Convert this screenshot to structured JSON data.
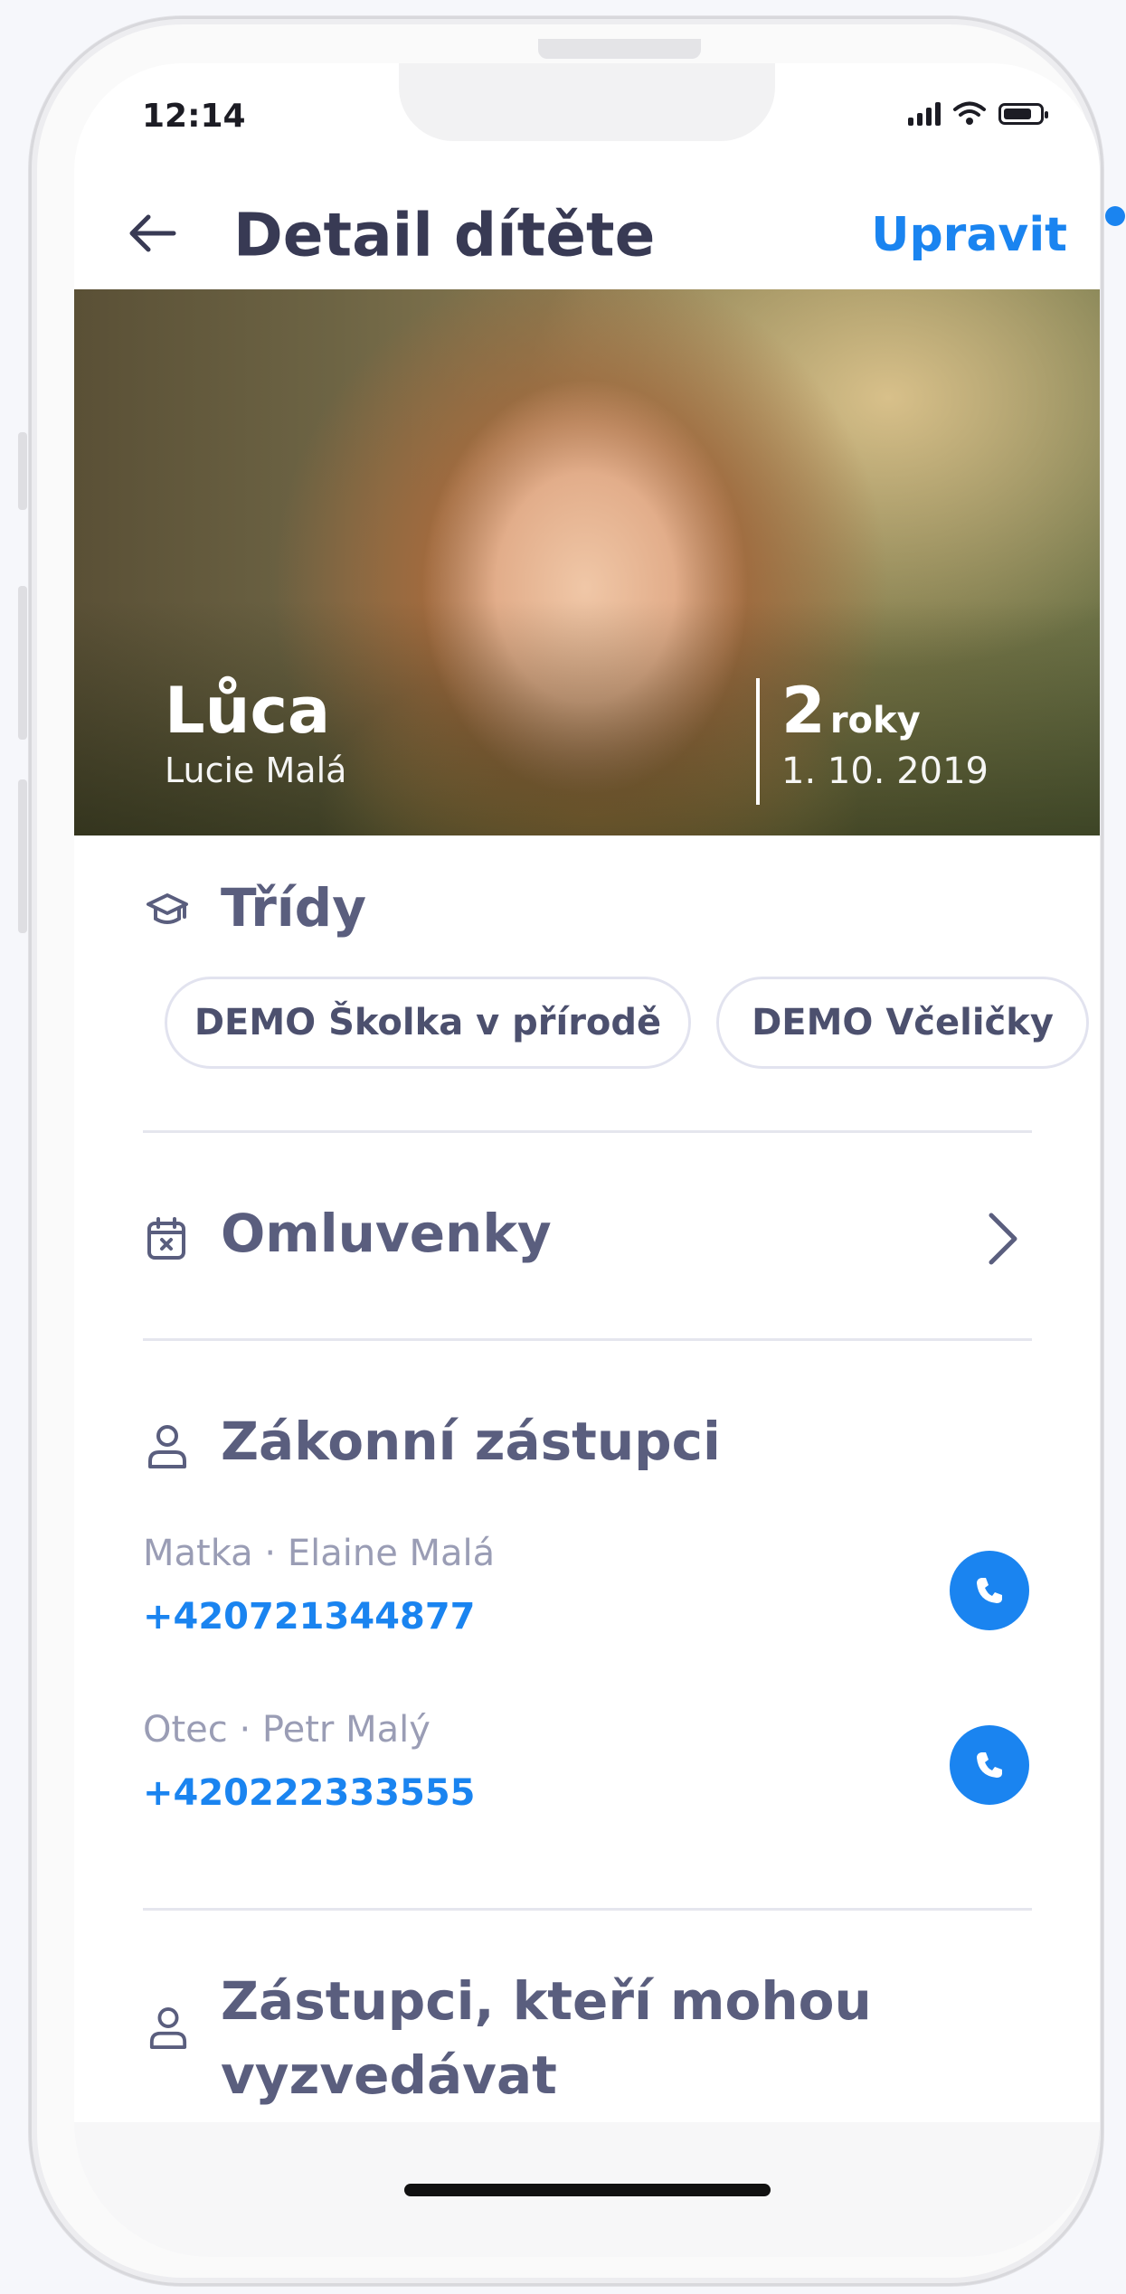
{
  "status_bar": {
    "time": "12:14"
  },
  "header": {
    "title": "Detail dítěte",
    "edit_label": "Upravit"
  },
  "child": {
    "nickname": "Lůca",
    "full_name": "Lucie Malá",
    "age_number": "2",
    "age_unit": "roky",
    "birth_date": "1. 10. 2019"
  },
  "classes": {
    "title": "Třídy",
    "items": [
      "DEMO Školka v přírodě",
      "DEMO Včeličky"
    ]
  },
  "excuses": {
    "title": "Omluvenky"
  },
  "guardians": {
    "title": "Zákonní zástupci",
    "items": [
      {
        "label": "Matka · Elaine Malá",
        "phone": "+420721344877"
      },
      {
        "label": "Otec · Petr Malý",
        "phone": "+420222333555"
      }
    ]
  },
  "pickup": {
    "title_line1": "Zástupci, kteří mohou",
    "title_line2": "vyzvedávat"
  },
  "icons": [
    "back-arrow-icon",
    "graduation-cap-icon",
    "calendar-x-icon",
    "chevron-right-icon",
    "person-icon",
    "phone-icon"
  ],
  "colors": {
    "accent": "#1a84f0",
    "title": "#383a54",
    "section": "#5a5e7e"
  }
}
